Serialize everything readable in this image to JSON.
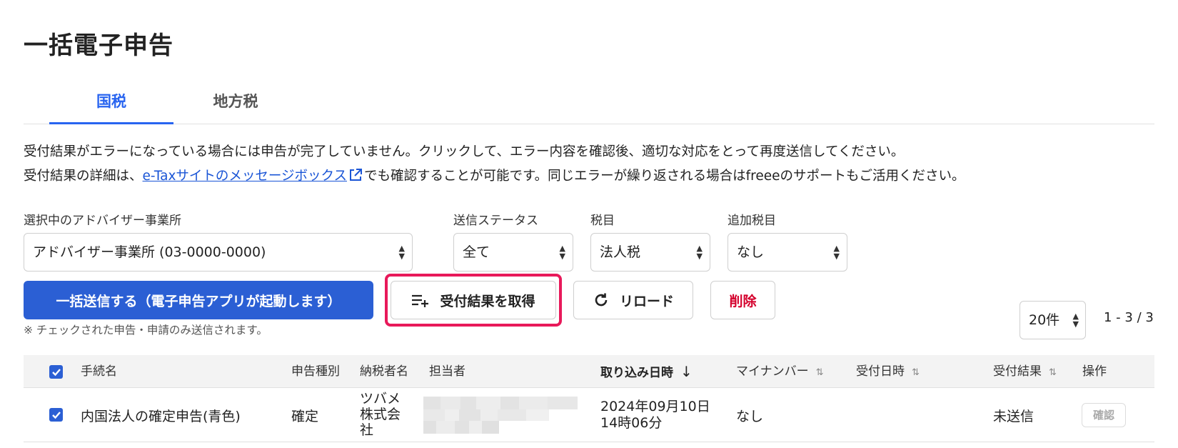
{
  "page": {
    "title": "一括電子申告"
  },
  "tabs": [
    {
      "label": "国税",
      "active": true
    },
    {
      "label": "地方税",
      "active": false
    }
  ],
  "notice": {
    "line1": "受付結果がエラーになっている場合には申告が完了していません。クリックして、エラー内容を確認後、適切な対応をとって再度送信してください。",
    "line2_before": "受付結果の詳細は、",
    "line2_link": "e-Taxサイトのメッセージボックス",
    "line2_after": "でも確認することが可能です。同じエラーが繰り返される場合はfreeeのサポートもご活用ください。"
  },
  "filters": {
    "office": {
      "label": "選択中のアドバイザー事業所",
      "value": "アドバイザー事業所 (03-0000-0000)"
    },
    "status": {
      "label": "送信ステータス",
      "value": "全て"
    },
    "tax": {
      "label": "税目",
      "value": "法人税"
    },
    "extra_tax": {
      "label": "追加税目",
      "value": "なし"
    }
  },
  "actions": {
    "bulk_send": "一括送信する（電子申告アプリが起動します）",
    "fetch_results": "受付結果を取得",
    "reload": "リロード",
    "delete": "削除",
    "send_note": "※ チェックされた申告・申請のみ送信されます。"
  },
  "pagination": {
    "per_page": "20件",
    "range": "1 - 3 / 3"
  },
  "table": {
    "headers": {
      "procedure": "手続名",
      "type": "申告種別",
      "taxpayer": "納税者名",
      "assignee": "担当者",
      "imported_at": "取り込み日時",
      "my_number": "マイナンバー",
      "received_at": "受付日時",
      "result": "受付結果",
      "operation": "操作"
    },
    "rows": [
      {
        "procedure": "内国法人の確定申告(青色)",
        "type": "確定",
        "taxpayer_l1": "ツバメ",
        "taxpayer_l2": "株式会",
        "taxpayer_l3": "社",
        "imported_l1": "2024年09月10日",
        "imported_l2": "14時06分",
        "my_number": "なし",
        "result": "未送信",
        "action": "確認"
      }
    ]
  },
  "colors": {
    "primary": "#2b5fd4",
    "danger": "#d4002c",
    "highlight": "#e8195a",
    "link": "#1a55d6"
  }
}
